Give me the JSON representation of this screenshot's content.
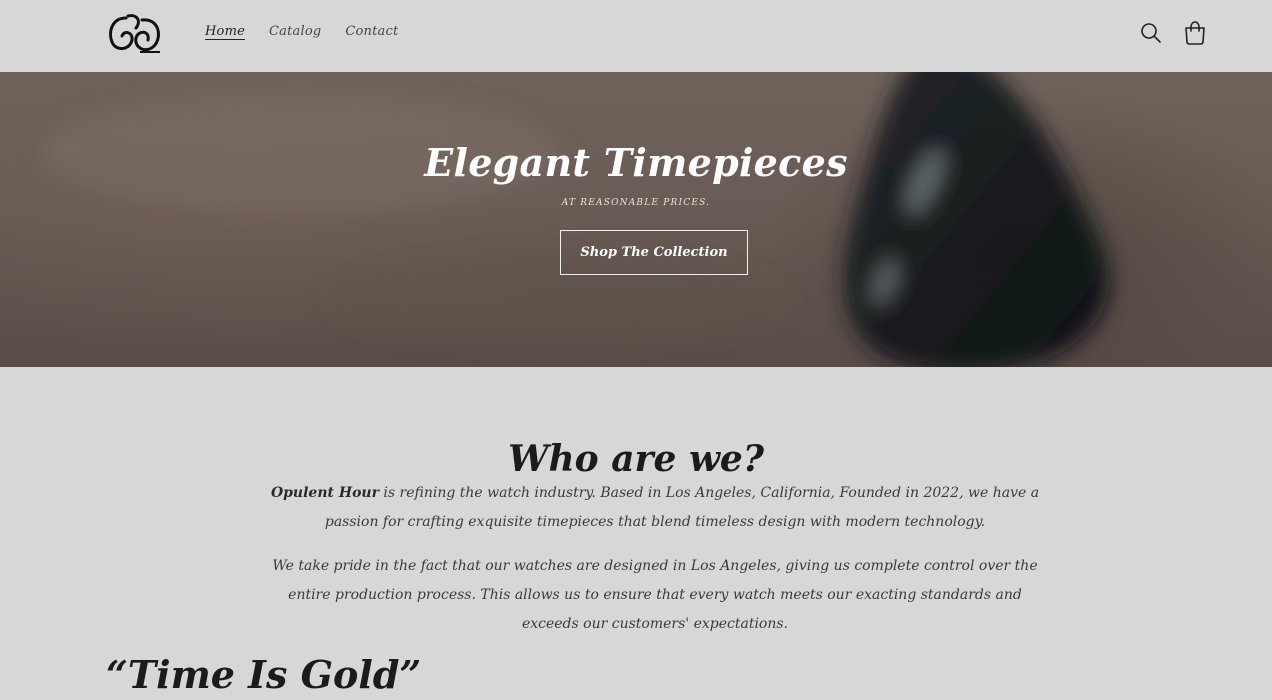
{
  "header": {
    "logo_alt": "Opulent Hour logo",
    "nav": [
      {
        "label": "Home",
        "active": true
      },
      {
        "label": "Catalog",
        "active": false
      },
      {
        "label": "Contact",
        "active": false
      }
    ],
    "icons": {
      "search": "search-icon",
      "cart": "cart-icon"
    }
  },
  "hero": {
    "title": "Elegant Timepieces",
    "subtitle": "AT REASONABLE PRICES.",
    "cta_label": "Shop The Collection"
  },
  "about": {
    "title": "Who are we?",
    "brand": "Opulent Hour",
    "p1_rest": " is refining the watch industry. Based in Los Angeles, California, Founded in 2022, we have a passion for crafting exquisite timepieces that blend timeless design with modern technology.",
    "p2": "We take pride in the fact that our watches are designed in Los Angeles, giving us complete control over the entire production process. This allows us to ensure that every watch meets our exacting standards and exceeds our customers' expectations."
  },
  "quote": {
    "title": "“Time Is Gold”"
  },
  "colors": {
    "background": "#d7d7d7",
    "hero_overlay": "#6a5c55",
    "text": "#2a2a2a",
    "hero_text": "#ffffff"
  }
}
